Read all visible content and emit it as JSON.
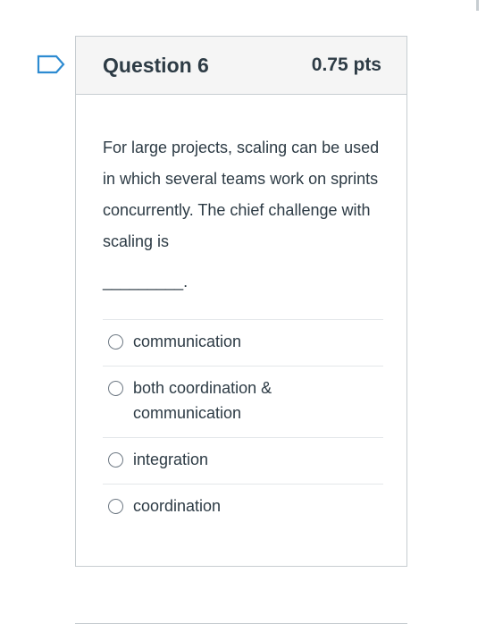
{
  "question": {
    "title": "Question 6",
    "points": "0.75 pts",
    "text": "For large projects, scaling can be used in which several teams work on sprints concurrently. The chief challenge with scaling is",
    "blank": "_________.",
    "flag_icon": "flag-icon"
  },
  "answers": [
    {
      "label_line1": "communication",
      "label_line2": "",
      "selected": false
    },
    {
      "label_line1": "both coordination &",
      "label_line2": "communication",
      "selected": false
    },
    {
      "label_line1": "integration",
      "label_line2": "",
      "selected": false
    },
    {
      "label_line1": "coordination",
      "label_line2": "",
      "selected": false
    }
  ],
  "colors": {
    "flag": "#2d8bd1",
    "header_bg": "#f5f5f5",
    "border": "#c7cdd1",
    "text": "#2d3b45"
  }
}
